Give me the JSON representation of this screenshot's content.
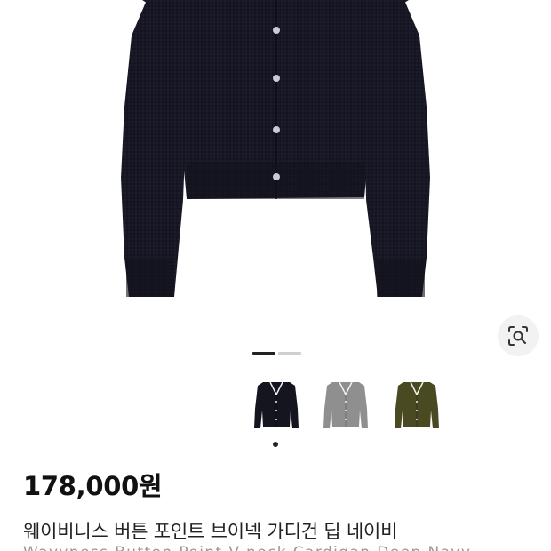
{
  "product": {
    "price": "178,000원",
    "name_ko": "웨이비니스 버튼 포인트 브이넥 가디건 딥 네이비",
    "name_en": "Wavyness Button Point V-neck Cardigan Deep Navy"
  },
  "gallery": {
    "slide_count": 2,
    "current_slide": 1,
    "lens_icon": "visual-search-icon"
  },
  "colors": {
    "navy": "#14151f",
    "gray": "#8f8f8f",
    "khaki": "#4a4a22",
    "indicator_active": "#222222",
    "indicator_inactive": "#cfcfcf"
  },
  "swatches": [
    {
      "name": "navy",
      "selected": true
    },
    {
      "name": "gray",
      "selected": false
    },
    {
      "name": "khaki",
      "selected": false
    }
  ]
}
